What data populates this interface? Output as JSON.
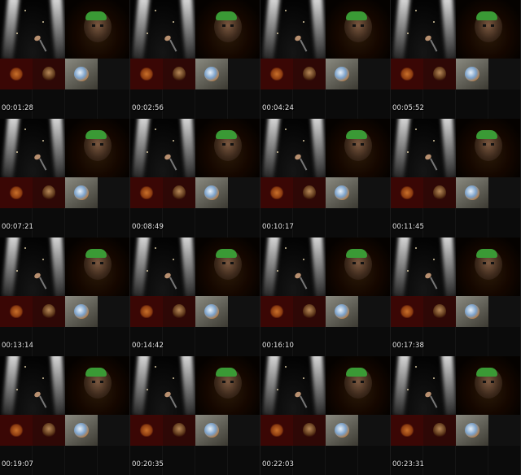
{
  "frames": [
    {
      "timestamp": "00:01:28"
    },
    {
      "timestamp": "00:02:56"
    },
    {
      "timestamp": "00:04:24"
    },
    {
      "timestamp": "00:05:52"
    },
    {
      "timestamp": "00:07:21"
    },
    {
      "timestamp": "00:08:49"
    },
    {
      "timestamp": "00:10:17"
    },
    {
      "timestamp": "00:11:45"
    },
    {
      "timestamp": "00:13:14"
    },
    {
      "timestamp": "00:14:42"
    },
    {
      "timestamp": "00:16:10"
    },
    {
      "timestamp": "00:17:38"
    },
    {
      "timestamp": "00:19:07"
    },
    {
      "timestamp": "00:20:35"
    },
    {
      "timestamp": "00:22:03"
    },
    {
      "timestamp": "00:23:31"
    }
  ],
  "colors": {
    "turban": "#3a9a35",
    "crest_background": "#3a0705",
    "timestamp_text": "#e8e8e8"
  },
  "icons": {
    "stage": "stage-spotlight-icon",
    "microphone": "microphone-icon",
    "portrait": "portrait-thumbnail",
    "crest": "crest-emblem-icon",
    "globe": "globe-icon"
  }
}
